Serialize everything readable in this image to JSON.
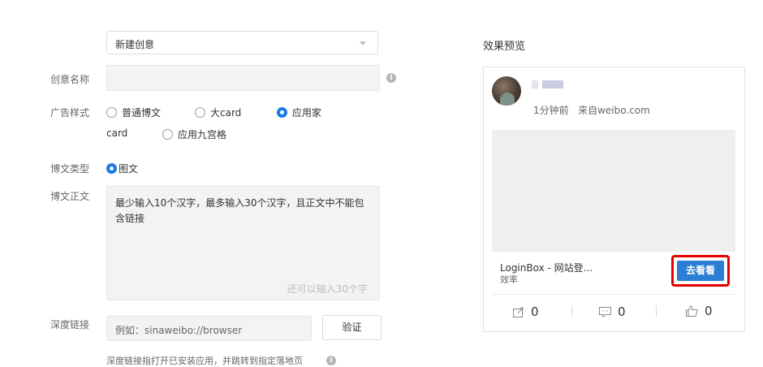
{
  "form": {
    "creative_select": "新建创意",
    "creative_name_label": "创意名称",
    "creative_name_value": "",
    "ad_style_label": "广告样式",
    "ad_style_options": [
      "普通博文",
      "大card",
      "应用家",
      "card",
      "应用九宫格"
    ],
    "ad_style_selected": "应用家",
    "post_type_label": "博文类型",
    "post_type_option": "图文",
    "post_body_label": "博文正文",
    "post_body_placeholder_line1": "最少输入10个汉字，最多输入30个汉字，且正文中不能包",
    "post_body_placeholder_line2": "含链接",
    "post_body_counter": "还可以输入30个字",
    "deeplink_label": "深度链接",
    "deeplink_placeholder": "例如：sinaweibo://browser",
    "verify_button": "验证",
    "deeplink_hint": "深度链接指打开已安装应用，并跳转到指定落地页"
  },
  "preview": {
    "title": "效果预览",
    "time": "1分钟前",
    "source": "来自weibo.com",
    "app_title": "LoginBox - 网站登...",
    "app_subtitle": "效率",
    "go_button": "去看看",
    "repost_count": "0",
    "comment_count": "0",
    "like_count": "0"
  },
  "colors": {
    "accent": "#1a7be6",
    "go_button": "#2a7fd4",
    "highlight_border": "#e30000"
  }
}
